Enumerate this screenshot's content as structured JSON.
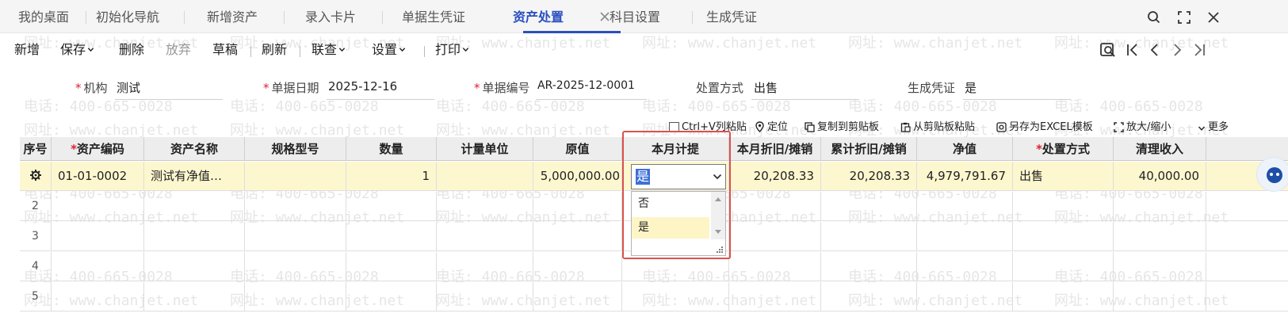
{
  "tabs": [
    {
      "label": "我的桌面"
    },
    {
      "label": "初始化导航"
    },
    {
      "label": "新增资产"
    },
    {
      "label": "录入卡片"
    },
    {
      "label": "单据生凭证"
    },
    {
      "label": "资产处置"
    },
    {
      "label": "科目设置"
    },
    {
      "label": "生成凭证"
    }
  ],
  "active_tab": "资产处置",
  "toolbar": {
    "new": "新增",
    "save": "保存",
    "delete": "删除",
    "discard": "放弃",
    "draft": "草稿",
    "refresh": "刷新",
    "query": "联查",
    "settings": "设置",
    "print": "打印"
  },
  "form": {
    "org_label": "机构",
    "org_value": "测试",
    "date_label": "单据日期",
    "date_value": "2025-12-16",
    "code_label": "单据编号",
    "code_value": "AR-2025-12-0001",
    "method_label": "处置方式",
    "method_value": "出售",
    "voucher_label": "生成凭证",
    "voucher_value": "是"
  },
  "grid_toolbar": {
    "paste_col": "Ctrl+V列粘贴",
    "locate": "定位",
    "copy_clip": "复制到剪贴板",
    "paste_clip": "从剪贴板粘贴",
    "save_excel": "另存为EXCEL模板",
    "zoom": "放大/缩小",
    "more": "更多"
  },
  "columns": [
    "序号",
    "资产编码",
    "资产名称",
    "规格型号",
    "数量",
    "计量单位",
    "原值",
    "本月计提",
    "本月折旧/摊销",
    "累计折旧/摊销",
    "净值",
    "处置方式",
    "清理收入"
  ],
  "rows": [
    {
      "code": "01-01-0002",
      "name": "测试有净值…",
      "spec": "",
      "qty": "1",
      "unit": "",
      "orig": "5,000,000.00",
      "accrue": "是",
      "month_dep": "20,208.33",
      "acc_dep": "20,208.33",
      "net": "4,979,791.67",
      "method": "出售",
      "income": "40,000.00"
    },
    {
      "idx": "2"
    },
    {
      "idx": "3"
    },
    {
      "idx": "4"
    },
    {
      "idx": "5"
    }
  ],
  "dropdown": {
    "options": [
      "否",
      "是"
    ],
    "selected": "是"
  },
  "watermark": {
    "phone": "电话: 400-665-0028",
    "site": "网址: www.chanjet.net"
  },
  "colors": {
    "accent": "#2b4fbf",
    "required": "#dd2233",
    "highlight": "#fdf7cf",
    "focus_frame": "#d9534f"
  }
}
